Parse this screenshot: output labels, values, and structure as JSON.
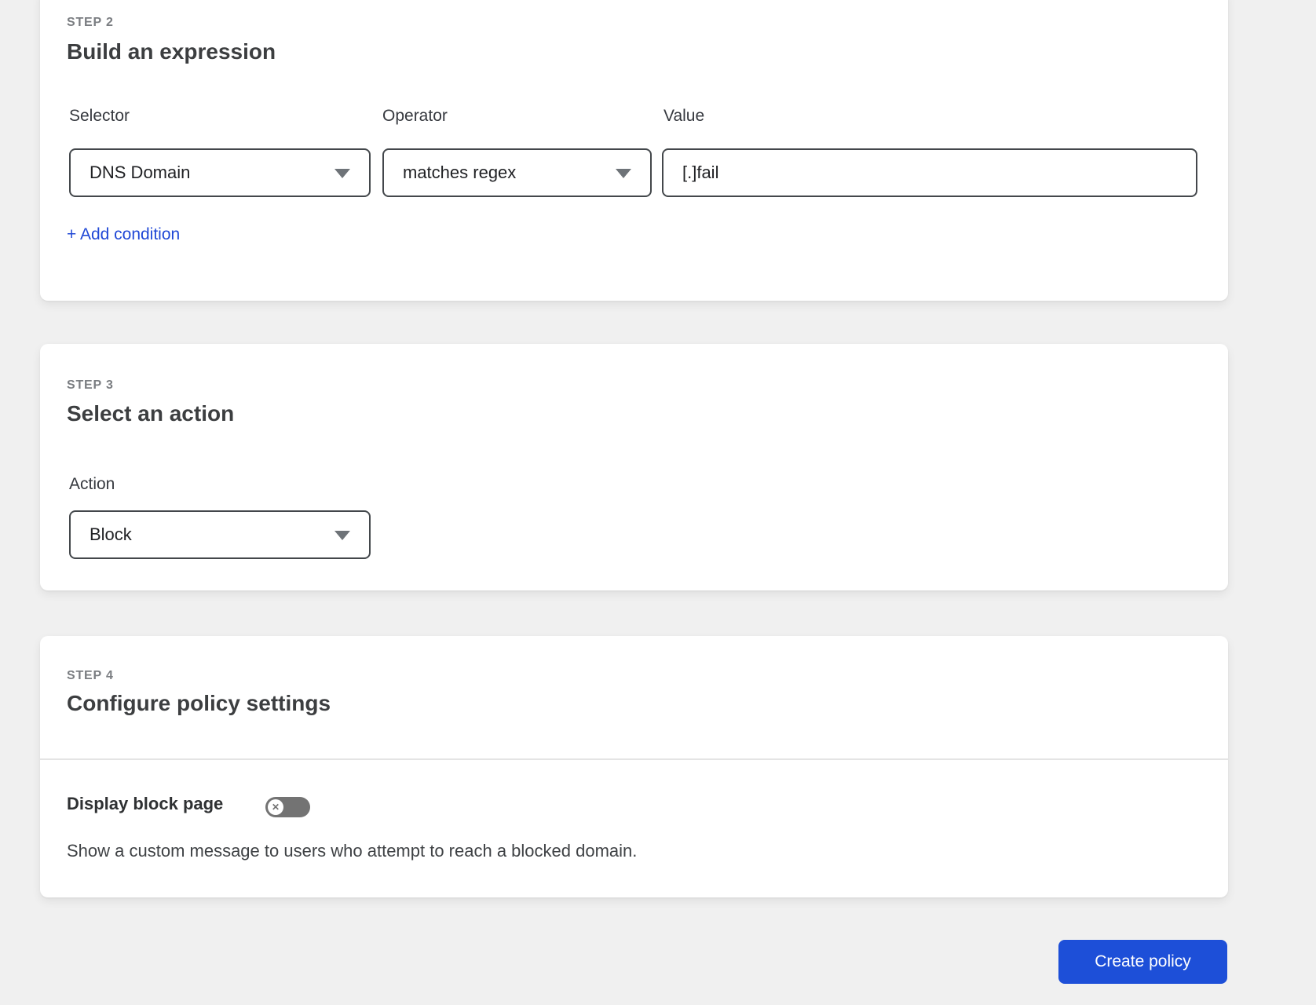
{
  "steps": {
    "step2": {
      "label": "STEP 2",
      "title": "Build an expression",
      "fields": {
        "selector": {
          "label": "Selector",
          "value": "DNS Domain"
        },
        "operator": {
          "label": "Operator",
          "value": "matches regex"
        },
        "value": {
          "label": "Value",
          "value": "[.]fail"
        }
      },
      "add_condition_label": "+ Add condition"
    },
    "step3": {
      "label": "STEP 3",
      "title": "Select an action",
      "fields": {
        "action": {
          "label": "Action",
          "value": "Block"
        }
      }
    },
    "step4": {
      "label": "STEP 4",
      "title": "Configure policy settings",
      "display_block_page": {
        "label": "Display block page",
        "toggle_state": "off",
        "description": "Show a custom message to users who attempt to reach a blocked domain."
      }
    }
  },
  "footer": {
    "create_policy_label": "Create policy"
  },
  "colors": {
    "page_bg": "#f0f0f0",
    "card_bg": "#ffffff",
    "accent_blue": "#1d4fd8",
    "link_blue": "#2048d6",
    "input_border": "#43474b",
    "toggle_off_gray": "#737373",
    "step_label_gray": "#7a7d81"
  }
}
